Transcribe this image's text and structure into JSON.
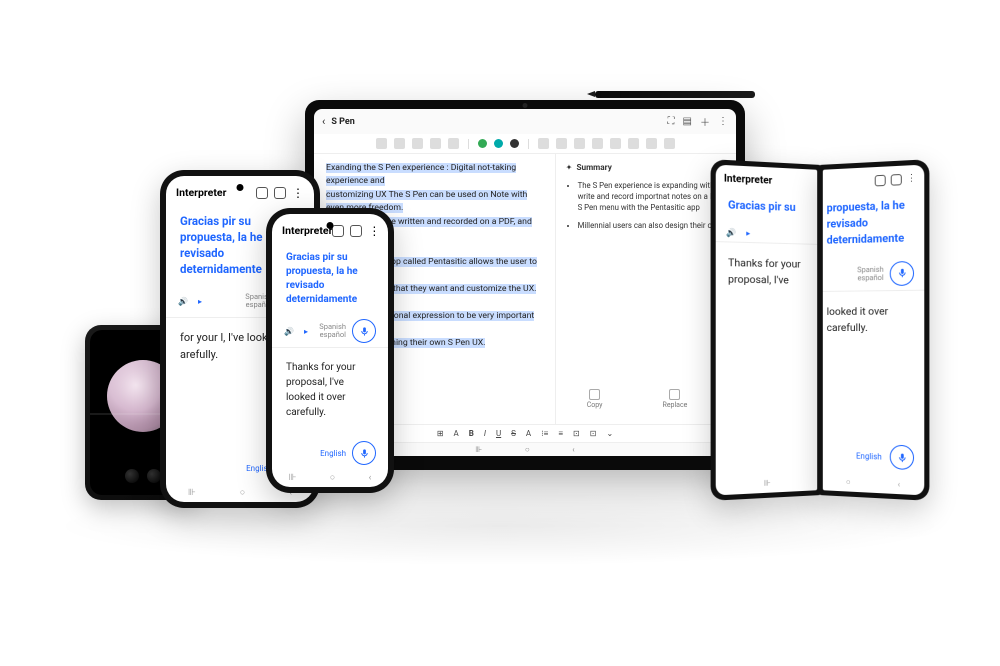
{
  "interpreter": {
    "title": "Interpreter",
    "translated_text": "Gracias pir su propuesta, la he revisado deternidamente",
    "source_text_full": "Thanks for your proposal, I've looked it over carefully.",
    "source_text_partial": "for your l, I've looked arefully.",
    "lang_target": "Spanish",
    "lang_target_native": "español",
    "lang_source": "English",
    "icons": {
      "speaker": "speaker-icon",
      "play": "play-icon",
      "mic": "mic-icon"
    }
  },
  "tablet": {
    "back_label": "‹",
    "title": "S Pen",
    "top_icons": [
      "expand-icon",
      "grid-icon",
      "add-icon",
      "more-icon"
    ],
    "toolbar_colors": [
      "#3a5",
      "#0aa",
      "#333"
    ],
    "note_line1": "Exanding the S Pen experience : Digital not-taking experience and",
    "note_line2": "customizing UX The S Pen can be used on Note with even more freedom.",
    "note_line3_a": "be written and recorded on a PDF, and the two contents",
    "note_line4_a": "app called Pentasitic allows the user to personalize",
    "note_line5_a": "s that they want and customize the UX. Also, millennial",
    "note_line6_a": "rsonal expression to be very important are afforded",
    "note_line7_a": "gning their own S Pen UX.",
    "summary_title": "Summary",
    "summary_items": [
      "The S Pen experience is expanding with write and record importnat notes on a PD S Pen menu with the Pentasitic app",
      "Millennial users can also design their own"
    ],
    "actions": {
      "copy": "Copy",
      "replace": "Replace"
    },
    "fmt": [
      "⊞",
      "A",
      "B",
      "I",
      "U",
      "S",
      "A",
      "⁝≡",
      "≡",
      "⊡",
      "⊡",
      "⌄"
    ]
  },
  "fold": {
    "title": "Interpreter",
    "blue_left": "Gracias pir su",
    "blue_right": "propuesta, la he revisado deternidamente",
    "reply_left": "Thanks for your proposal, I've",
    "reply_right": "looked it over carefully.",
    "lang_target": "Spanish",
    "lang_target_native": "español",
    "lang_source": "English"
  },
  "nav": {
    "recent": "⊪",
    "home": "○",
    "back": "‹"
  }
}
